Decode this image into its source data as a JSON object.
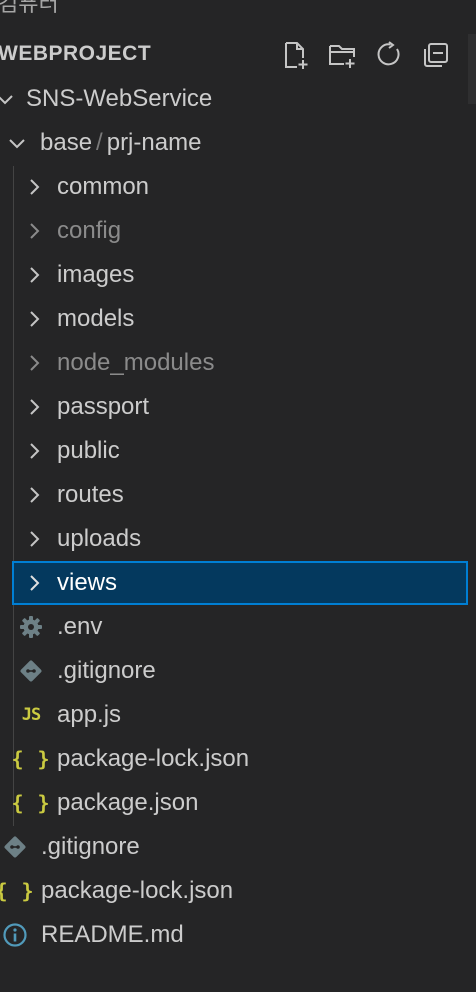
{
  "top_cut_text": "컴퓨터",
  "header": {
    "title": "WEBPROJECT",
    "actions": [
      {
        "name": "new-file-icon"
      },
      {
        "name": "new-folder-icon"
      },
      {
        "name": "refresh-icon"
      },
      {
        "name": "collapse-all-icon"
      }
    ]
  },
  "tree": {
    "root": {
      "label": "SNS-WebService",
      "expanded": true
    },
    "base_folder": {
      "part1": "base",
      "separator": "/",
      "part2": "prj-name",
      "expanded": true
    },
    "folders": [
      {
        "label": "common",
        "dim": false
      },
      {
        "label": "config",
        "dim": true
      },
      {
        "label": "images",
        "dim": false
      },
      {
        "label": "models",
        "dim": false
      },
      {
        "label": "node_modules",
        "dim": true
      },
      {
        "label": "passport",
        "dim": false
      },
      {
        "label": "public",
        "dim": false
      },
      {
        "label": "routes",
        "dim": false
      },
      {
        "label": "uploads",
        "dim": false
      },
      {
        "label": "views",
        "dim": false,
        "selected": true
      }
    ],
    "inner_files": [
      {
        "label": ".env",
        "icon": "gear-icon"
      },
      {
        "label": ".gitignore",
        "icon": "git-icon"
      },
      {
        "label": "app.js",
        "icon": "js-icon",
        "icon_text": "JS"
      },
      {
        "label": "package-lock.json",
        "icon": "json-icon",
        "icon_text": "{ }"
      },
      {
        "label": "package.json",
        "icon": "json-icon",
        "icon_text": "{ }"
      }
    ],
    "outer_files": [
      {
        "label": ".gitignore",
        "icon": "git-icon"
      },
      {
        "label": "package-lock.json",
        "icon": "json-icon",
        "icon_text": "{ }"
      },
      {
        "label": "README.md",
        "icon": "info-icon"
      }
    ]
  },
  "colors": {
    "background": "#252526",
    "text": "#cccccc",
    "dim_text": "#8b8b8b",
    "selection_bg": "#04395e",
    "selection_border": "#007fd4",
    "json_yellow": "#cbcb41",
    "icon_blue": "#519aba",
    "git_gray": "#6d8086"
  }
}
